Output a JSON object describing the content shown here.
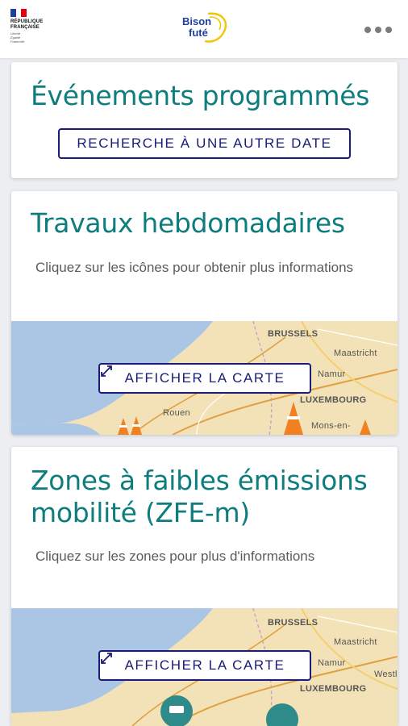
{
  "header": {
    "republic_logo_line1": "RÉPUBLIQUE",
    "republic_logo_line2": "FRANÇAISE",
    "republic_motto": [
      "Liberté",
      "Égalité",
      "Fraternité"
    ],
    "app_logo_line1": "Bison",
    "app_logo_line2": "futé",
    "menu_icon": "more-horizontal-icon"
  },
  "colors": {
    "title_teal": "#0e7d7d",
    "button_navy": "#1b1b78",
    "page_bg": "#eceef1",
    "map_land": "#f3e2b8",
    "map_sea": "#aac6e4"
  },
  "events_card": {
    "title": "Événements programmés",
    "button_label": "RECHERCHE À UNE AUTRE DATE"
  },
  "works_card": {
    "title": "Travaux hebdomadaires",
    "description": "Cliquez sur les icônes pour obtenir plus informations",
    "button_label": "AFFICHER LA CARTE",
    "button_icon": "expand-icon",
    "map_labels": [
      "BRUSSELS",
      "Maastricht",
      "Namur",
      "LUXEMBOURG",
      "Rouen",
      "Mons-en-"
    ]
  },
  "zfe_card": {
    "title_line1": "Zones à faibles émissions",
    "title_line2": "mobilité (ZFE-m)",
    "description": "Cliquez sur les zones pour plus d'informations",
    "button_label": "AFFICHER LA CARTE",
    "button_icon": "expand-icon",
    "map_labels": [
      "BRUSSELS",
      "Maastricht",
      "Namur",
      "LUXEMBOURG",
      "Westl"
    ]
  }
}
